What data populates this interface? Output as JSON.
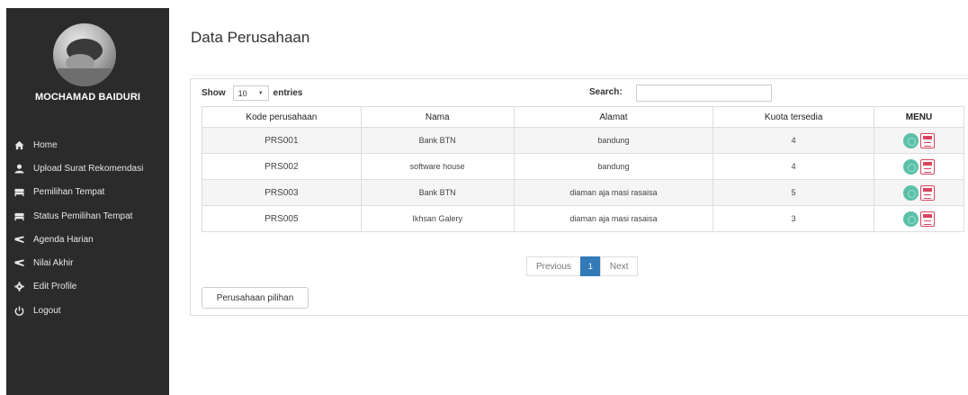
{
  "sidebar": {
    "username": "MOCHAMAD BAIDURI",
    "items": [
      {
        "label": "Home",
        "icon": "home-icon"
      },
      {
        "label": "Upload Surat Rekomendasi",
        "icon": "user-icon"
      },
      {
        "label": "Pemilihan Tempat",
        "icon": "bed-icon"
      },
      {
        "label": "Status Pemilihan Tempat",
        "icon": "bed-icon"
      },
      {
        "label": "Agenda Harian",
        "icon": "calendar-icon"
      },
      {
        "label": "Nilai Akhir",
        "icon": "pencil-icon"
      },
      {
        "label": "Edit Profile",
        "icon": "gear-icon"
      },
      {
        "label": "Logout",
        "icon": "power-icon"
      }
    ]
  },
  "main": {
    "title": "Data Perusahaan",
    "show_label": "Show",
    "entries_value": "10",
    "entries_label": "entries",
    "search_label": "Search:",
    "search_value": "",
    "columns": [
      "Kode perusahaan",
      "Nama",
      "Alamat",
      "Kuota tersedia",
      "MENU"
    ],
    "rows": [
      {
        "kode": "PRS001",
        "nama": "Bank BTN",
        "alamat": "bandung",
        "kuota": "4"
      },
      {
        "kode": "PRS002",
        "nama": "software house",
        "alamat": "bandung",
        "kuota": "4"
      },
      {
        "kode": "PRS003",
        "nama": "Bank BTN",
        "alamat": "diaman aja masi rasaisa",
        "kuota": "5"
      },
      {
        "kode": "PRS005",
        "nama": "Ikhsan Galery",
        "alamat": "diaman aja masi rasaisa",
        "kuota": "3"
      }
    ],
    "pagination": {
      "previous": "Previous",
      "current": "1",
      "next": "Next"
    },
    "pilihan_button": "Perusahaan pilihan"
  },
  "colors": {
    "sidebar_bg": "#2b2b2b",
    "primary": "#337ab7",
    "action_green": "#5bc0a8",
    "action_red": "#d9455f"
  }
}
